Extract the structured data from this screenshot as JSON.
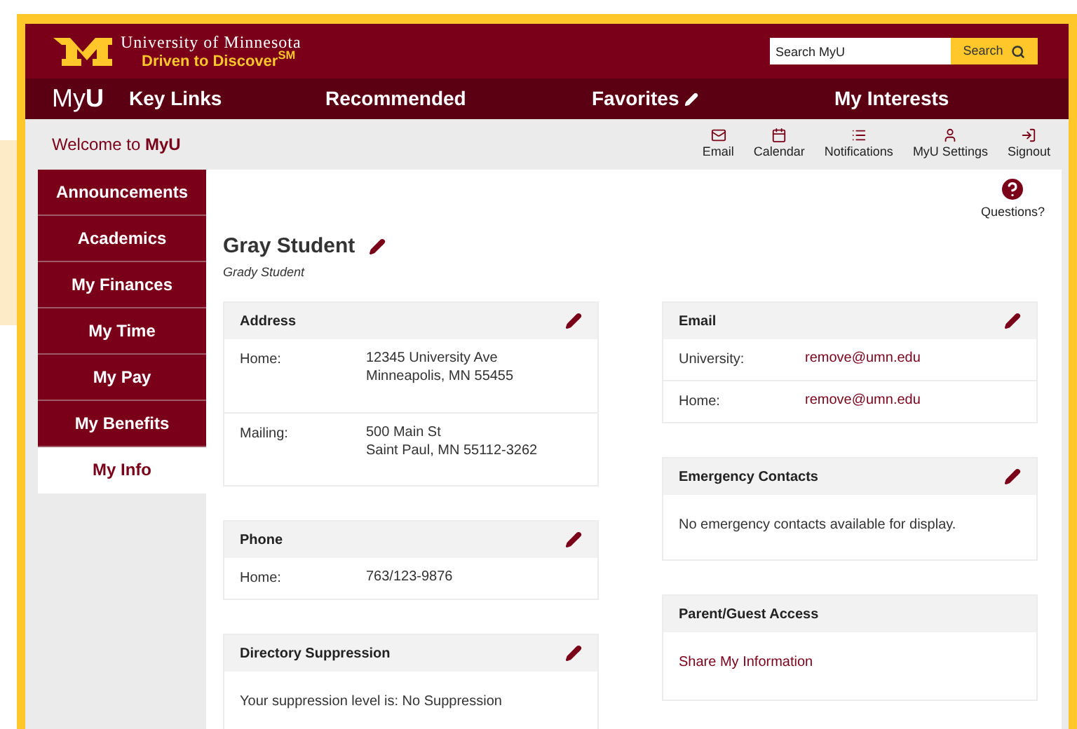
{
  "header": {
    "university": "University of Minnesota",
    "tagline": "Driven to Discover$^{SM}$",
    "search": {
      "placeholder": "Search MyU",
      "button": "Search"
    }
  },
  "nav": {
    "brand": "My**U**",
    "items": [
      {
        "label": "Key Links",
        "editable": false
      },
      {
        "label": "Recommended",
        "editable": false
      },
      {
        "label": "Favorites",
        "editable": true
      },
      {
        "label": "My Interests",
        "editable": false
      }
    ]
  },
  "welcome": "Welcome to **MyU**",
  "toolbar": [
    {
      "kind": "email",
      "label": "Email"
    },
    {
      "kind": "calendar",
      "label": "Calendar"
    },
    {
      "kind": "notifications",
      "label": "Notifications"
    },
    {
      "kind": "settings",
      "label": "MyU Settings"
    },
    {
      "kind": "signout",
      "label": "Signout"
    }
  ],
  "sidebar": {
    "items": [
      {
        "label": "Announcements",
        "selected": false
      },
      {
        "label": "Academics",
        "selected": false
      },
      {
        "label": "My Finances",
        "selected": false
      },
      {
        "label": "My Time",
        "selected": false
      },
      {
        "label": "My Pay",
        "selected": false
      },
      {
        "label": "My Benefits",
        "selected": false
      },
      {
        "label": "My Info",
        "selected": true
      }
    ]
  },
  "help": "Questions?",
  "profile": {
    "name": "Gray Student",
    "subname": "Grady Student",
    "editable": true
  },
  "columns": [
    [
      {
        "title": "Address",
        "editable": true,
        "kind": "rows",
        "rows": [
          {
            "label": "Home:",
            "lines": [
              "12345 University Ave",
              "Minneapolis, MN 55455"
            ],
            "link": false
          },
          {
            "label": "Mailing:",
            "lines": [
              "500 Main St",
              "Saint Paul, MN 55112-3262"
            ],
            "link": false
          }
        ]
      },
      {
        "title": "Phone",
        "editable": true,
        "kind": "rows",
        "rows": [
          {
            "label": "Home:",
            "lines": [
              "763/123-9876"
            ],
            "link": false
          }
        ]
      },
      {
        "title": "Directory Suppression",
        "editable": true,
        "kind": "text",
        "text": "Your suppression level is: No Suppression"
      }
    ],
    [
      {
        "title": "Email",
        "editable": true,
        "kind": "rows",
        "rows": [
          {
            "label": "University:",
            "lines": [
              "remove@umn.edu"
            ],
            "link": true
          },
          {
            "label": "Home:",
            "lines": [
              "remove@umn.edu"
            ],
            "link": true
          }
        ]
      },
      {
        "title": "Emergency Contacts",
        "editable": true,
        "kind": "text",
        "text": "No emergency contacts available for display."
      },
      {
        "title": "Parent/Guest Access",
        "editable": false,
        "kind": "link",
        "text": "Share My Information"
      }
    ]
  ]
}
